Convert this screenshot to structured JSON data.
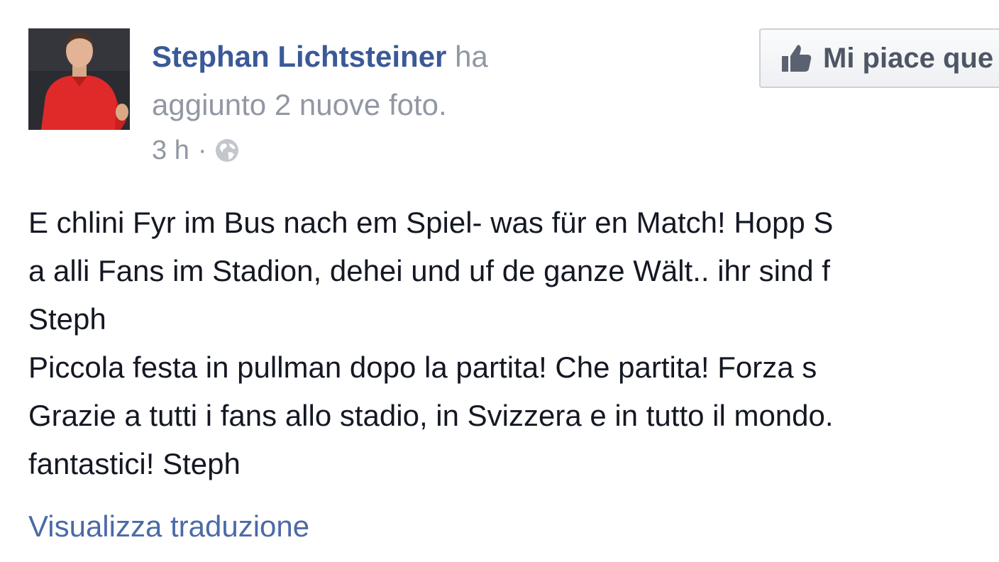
{
  "post": {
    "author_name": "Stephan Lichtsteiner",
    "action_text_1": " ha",
    "action_text_2": "aggiunto 2 nuove foto.",
    "timestamp": "3 h",
    "separator": "·",
    "privacy_icon": "globe-icon",
    "like_button": {
      "icon": "thumbs-up-icon",
      "label": "Mi piace que"
    },
    "message_lines": [
      "E chlini Fyr im Bus nach em Spiel- was für en Match! Hopp S",
      "a alli Fans im Stadion, dehei und uf de ganze Wält.. ihr sind f",
      "Steph",
      "Piccola festa in pullman dopo la partita! Che partita! Forza s",
      "Grazie a tutti i fans allo stadio, in Svizzera e in tutto il mondo.",
      "fantastici! Steph"
    ],
    "translate_link": "Visualizza traduzione"
  },
  "colors": {
    "author": "#3b5998",
    "muted": "#9197a3",
    "body": "#141823",
    "link": "#4b6aa6"
  }
}
